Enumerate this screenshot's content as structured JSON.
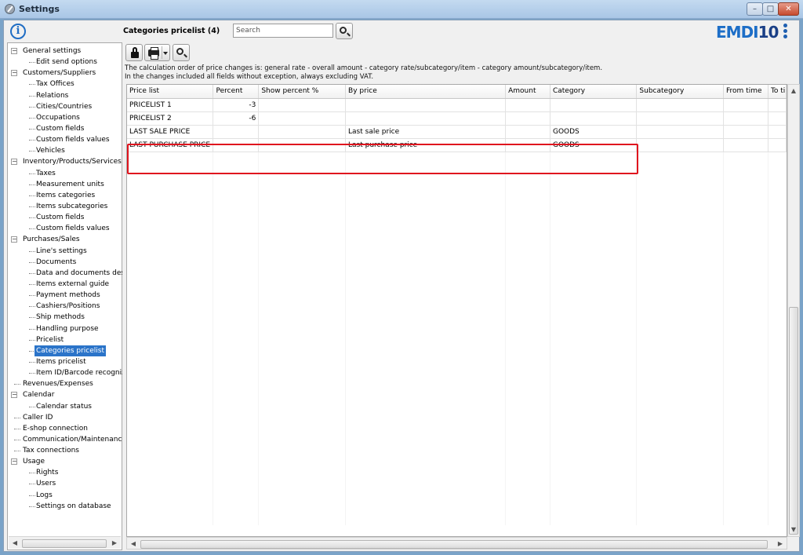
{
  "window": {
    "title": "Settings",
    "controls": {
      "minimize": "–",
      "maximize": "□",
      "close": "✕"
    }
  },
  "header": {
    "page_title": "Categories pricelist (4)",
    "search_placeholder": "Search",
    "logo_text": "EMDI",
    "logo_number": "10"
  },
  "sidebar": {
    "items": [
      {
        "label": "General settings",
        "level": 0,
        "expanded": true
      },
      {
        "label": "Edit send options",
        "level": 1
      },
      {
        "label": "Customers/Suppliers",
        "level": 0,
        "expanded": true
      },
      {
        "label": "Tax Offices",
        "level": 1
      },
      {
        "label": "Relations",
        "level": 1
      },
      {
        "label": "Cities/Countries",
        "level": 1
      },
      {
        "label": "Occupations",
        "level": 1
      },
      {
        "label": "Custom fields",
        "level": 1
      },
      {
        "label": "Custom fields values",
        "level": 1
      },
      {
        "label": "Vehicles",
        "level": 1
      },
      {
        "label": "Inventory/Products/Services",
        "level": 0,
        "expanded": true
      },
      {
        "label": "Taxes",
        "level": 1
      },
      {
        "label": "Measurement units",
        "level": 1
      },
      {
        "label": "Items categories",
        "level": 1
      },
      {
        "label": "Items subcategories",
        "level": 1
      },
      {
        "label": "Custom fields",
        "level": 1
      },
      {
        "label": "Custom fields values",
        "level": 1
      },
      {
        "label": "Purchases/Sales",
        "level": 0,
        "expanded": true
      },
      {
        "label": "Line's settings",
        "level": 1
      },
      {
        "label": "Documents",
        "level": 1
      },
      {
        "label": "Data and documents desi",
        "level": 1
      },
      {
        "label": "Items external guide",
        "level": 1
      },
      {
        "label": "Payment methods",
        "level": 1
      },
      {
        "label": "Cashiers/Positions",
        "level": 1
      },
      {
        "label": "Ship methods",
        "level": 1
      },
      {
        "label": "Handling purpose",
        "level": 1
      },
      {
        "label": "Pricelist",
        "level": 1
      },
      {
        "label": "Categories pricelist",
        "level": 1,
        "selected": true
      },
      {
        "label": "Items pricelist",
        "level": 1
      },
      {
        "label": "Item ID/Barcode recognize",
        "level": 1
      },
      {
        "label": "Revenues/Expenses",
        "level": 0
      },
      {
        "label": "Calendar",
        "level": 0,
        "expanded": true
      },
      {
        "label": "Calendar status",
        "level": 1
      },
      {
        "label": "Caller ID",
        "level": 0
      },
      {
        "label": "E-shop connection",
        "level": 0
      },
      {
        "label": "Communication/Maintenance",
        "level": 0
      },
      {
        "label": "Tax connections",
        "level": 0
      },
      {
        "label": "Usage",
        "level": 0,
        "expanded": true
      },
      {
        "label": "Rights",
        "level": 1
      },
      {
        "label": "Users",
        "level": 1
      },
      {
        "label": "Logs",
        "level": 1
      },
      {
        "label": "Settings on database",
        "level": 1
      }
    ]
  },
  "notes": {
    "line1": "The calculation order of price changes  is: general rate - overall amount - category rate/subcategory/item - category amount/subcategory/item.",
    "line2": "In the changes included all fields without exception, always excluding VAT."
  },
  "grid": {
    "columns": [
      "Price list",
      "Percent",
      "Show percent %",
      "By price",
      "Amount",
      "Category",
      "Subcategory",
      "From time",
      "To ti"
    ],
    "rows": [
      [
        "PRICELIST 1",
        "-3",
        "",
        "",
        "",
        "",
        "",
        "",
        ""
      ],
      [
        "PRICELIST 2",
        "-6",
        "",
        "",
        "",
        "",
        "",
        "",
        ""
      ],
      [
        "LAST SALE PRICE",
        "",
        "",
        "Last sale price",
        "",
        "GOODS",
        "",
        "",
        ""
      ],
      [
        "LAST PURCHASE PRICE",
        "",
        "",
        "Last purchase price",
        "",
        "GOODS",
        "",
        "",
        ""
      ]
    ]
  }
}
